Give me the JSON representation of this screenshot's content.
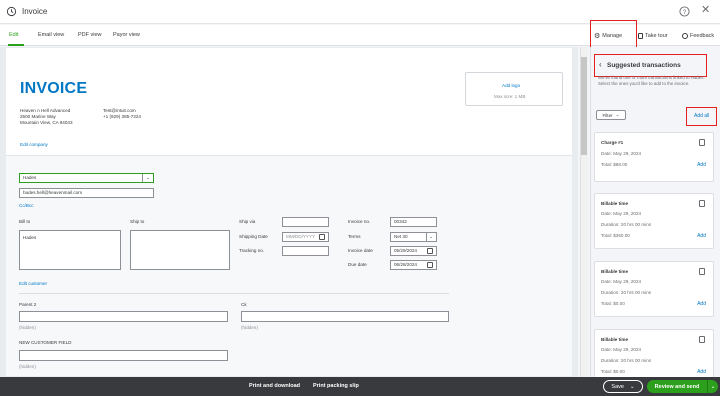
{
  "window": {
    "title": "Invoice"
  },
  "tabs": [
    {
      "label": "Edit"
    },
    {
      "label": "Email view"
    },
    {
      "label": "PDF view"
    },
    {
      "label": "Payor view"
    }
  ],
  "toolbar": {
    "manage": "Manage",
    "take_tour": "Take tour",
    "feedback": "Feedback"
  },
  "header": {
    "invoice_title": "INVOICE",
    "company_name": "Heaven n Hell Advanced",
    "address_1": "2500 Marine Way",
    "address_2": "Mountain View, CA 94043",
    "email": "Test@intuit.com",
    "phone": "+1 (929) 385-7324",
    "edit_company": "Edit company",
    "add_logo": "Add logo",
    "max_size": "Max size: 1 MB"
  },
  "customer": {
    "name": "Hades",
    "email": "hades.hell@heavenmail.com",
    "cc_bcc": "Cc/Bcc",
    "bill_to_label": "Bill to",
    "bill_to_value": "Hades",
    "ship_to_label": "Ship to",
    "edit_customer": "Edit customer"
  },
  "shipping": {
    "ship_via_label": "Ship via",
    "shipping_date_label": "Shipping Date",
    "shipping_date_placeholder": "MM/DD/YYYY",
    "tracking_label": "Tracking no."
  },
  "invoice_meta": {
    "invoice_no_label": "Invoice no.",
    "invoice_no": "00342",
    "terms_label": "Terms",
    "terms": "Net 30",
    "invoice_date_label": "Invoice date",
    "invoice_date": "05/29/2024",
    "due_date_label": "Due date",
    "due_date": "06/28/2024"
  },
  "custom_fields": {
    "parent_label": "Parent 2",
    "ck_label": "Ck",
    "hidden_1": "(hidden)",
    "hidden_2": "(hidden)",
    "new_field_label": "NEW CUSTOMER FIELD",
    "hidden_3": "(hidden)"
  },
  "panel": {
    "title": "Suggested transactions",
    "description": "We've found one or more transactions linked to Hades. Select the ones you'd like to add to the invoice.",
    "filter": "Filter",
    "add_all": "Add all",
    "cards": [
      {
        "title": "Charge #1",
        "lines": [
          "Date:   May 29, 2024",
          "Total:   $88.00"
        ],
        "add": "Add"
      },
      {
        "title": "Billable time",
        "lines": [
          "Date:      May 29, 2024",
          "Duration:   20 hrs 00 mins",
          "Total:    $360.00"
        ],
        "add": "Add"
      },
      {
        "title": "Billable time",
        "lines": [
          "Date:      May 29, 2024",
          "Duration:   20 hrs 00 mins",
          "Total:    $0.00"
        ],
        "add": "Add"
      },
      {
        "title": "Billable time",
        "lines": [
          "Date:      May 29, 2024",
          "Duration:   20 hrs 00 mins",
          "Total:    $0.00"
        ],
        "add": "Add"
      }
    ]
  },
  "footer": {
    "print_download": "Print and download",
    "print_packing": "Print packing slip",
    "save": "Save",
    "review_send": "Review and send"
  },
  "colors": {
    "accent": "#2ca01c",
    "link": "#0077c5",
    "highlight_box": "#e3201b",
    "footer": "#393a3d"
  }
}
